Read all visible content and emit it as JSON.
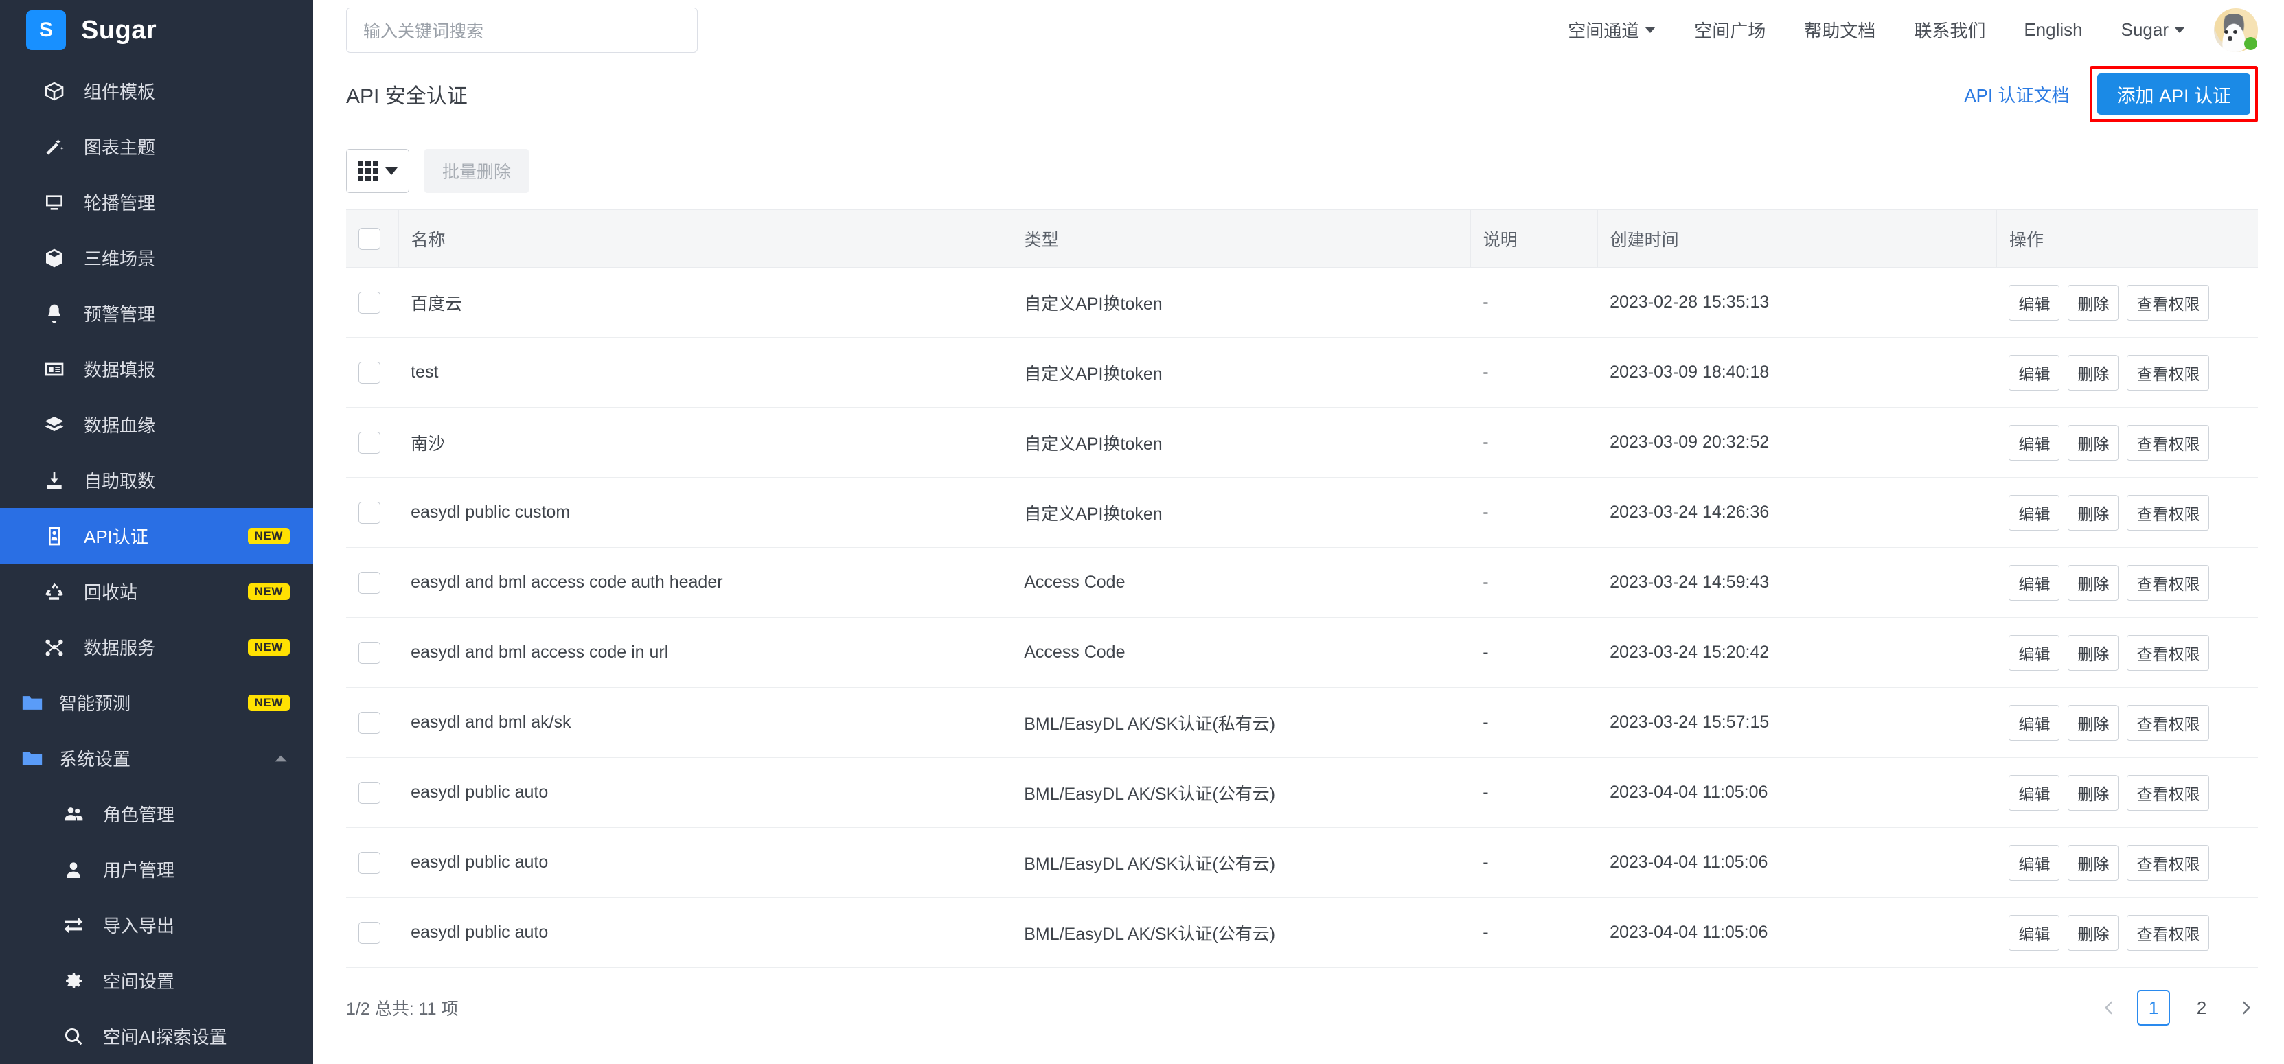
{
  "sidebar": {
    "brand": {
      "logo_letter": "S",
      "name": "Sugar"
    },
    "items": [
      {
        "label": "组件模板",
        "icon": "cube-outline-icon",
        "badge": "",
        "type": "item"
      },
      {
        "label": "图表主题",
        "icon": "magic-wand-icon",
        "badge": "",
        "type": "item"
      },
      {
        "label": "轮播管理",
        "icon": "monitor-icon",
        "badge": "",
        "type": "item"
      },
      {
        "label": "三维场景",
        "icon": "cube-solid-icon",
        "badge": "",
        "type": "item"
      },
      {
        "label": "预警管理",
        "icon": "bell-icon",
        "badge": "",
        "type": "item"
      },
      {
        "label": "数据填报",
        "icon": "id-card-icon",
        "badge": "",
        "type": "item"
      },
      {
        "label": "数据血缘",
        "icon": "layers-icon",
        "badge": "",
        "type": "item"
      },
      {
        "label": "自助取数",
        "icon": "download-icon",
        "badge": "",
        "type": "item"
      },
      {
        "label": "API认证",
        "icon": "api-badge-icon",
        "badge": "NEW",
        "type": "item",
        "active": true
      },
      {
        "label": "回收站",
        "icon": "recycle-icon",
        "badge": "NEW",
        "type": "item"
      },
      {
        "label": "数据服务",
        "icon": "nodes-icon",
        "badge": "NEW",
        "type": "item"
      },
      {
        "label": "智能预测",
        "icon": "folder-icon",
        "badge": "NEW",
        "type": "group"
      },
      {
        "label": "系统设置",
        "icon": "folder-icon",
        "badge": "",
        "type": "group",
        "expanded": true
      },
      {
        "label": "角色管理",
        "icon": "users-icon",
        "badge": "",
        "type": "child"
      },
      {
        "label": "用户管理",
        "icon": "user-icon",
        "badge": "",
        "type": "child"
      },
      {
        "label": "导入导出",
        "icon": "exchange-icon",
        "badge": "",
        "type": "child"
      },
      {
        "label": "空间设置",
        "icon": "gear-icon",
        "badge": "",
        "type": "child"
      },
      {
        "label": "空间AI探索设置",
        "icon": "search-icon",
        "badge": "",
        "type": "child"
      }
    ]
  },
  "topbar": {
    "search_placeholder": "输入关键词搜索",
    "nav": [
      {
        "label": "空间通道",
        "has_caret": true
      },
      {
        "label": "空间广场",
        "has_caret": false
      },
      {
        "label": "帮助文档",
        "has_caret": false
      },
      {
        "label": "联系我们",
        "has_caret": false
      },
      {
        "label": "English",
        "has_caret": false
      },
      {
        "label": "Sugar",
        "has_caret": true
      }
    ]
  },
  "pagehead": {
    "title": "API 安全认证",
    "doc_link": "API 认证文档",
    "add_button": "添加 API 认证",
    "highlight_color": "#ff0000",
    "accent_color": "#1b8ae6"
  },
  "toolbar": {
    "grid_button_icon": "grid-icon",
    "batch_delete": "批量删除"
  },
  "table": {
    "columns": [
      "名称",
      "类型",
      "说明",
      "创建时间",
      "操作"
    ],
    "op_labels": {
      "edit": "编辑",
      "delete": "删除",
      "permission": "查看权限"
    },
    "rows": [
      {
        "name": "百度云",
        "type": "自定义API换token",
        "desc": "-",
        "created": "2023-02-28 15:35:13"
      },
      {
        "name": "test",
        "type": "自定义API换token",
        "desc": "-",
        "created": "2023-03-09 18:40:18"
      },
      {
        "name": "南沙",
        "type": "自定义API换token",
        "desc": "-",
        "created": "2023-03-09 20:32:52"
      },
      {
        "name": "easydl public custom",
        "type": "自定义API换token",
        "desc": "-",
        "created": "2023-03-24 14:26:36"
      },
      {
        "name": "easydl and bml access code auth header",
        "type": "Access Code",
        "desc": "-",
        "created": "2023-03-24 14:59:43"
      },
      {
        "name": "easydl and bml access code in url",
        "type": "Access Code",
        "desc": "-",
        "created": "2023-03-24 15:20:42"
      },
      {
        "name": "easydl and bml ak/sk",
        "type": "BML/EasyDL AK/SK认证(私有云)",
        "desc": "-",
        "created": "2023-03-24 15:57:15"
      },
      {
        "name": "easydl public auto",
        "type": "BML/EasyDL AK/SK认证(公有云)",
        "desc": "-",
        "created": "2023-04-04 11:05:06"
      },
      {
        "name": "easydl public auto",
        "type": "BML/EasyDL AK/SK认证(公有云)",
        "desc": "-",
        "created": "2023-04-04 11:05:06"
      },
      {
        "name": "easydl public auto",
        "type": "BML/EasyDL AK/SK认证(公有云)",
        "desc": "-",
        "created": "2023-04-04 11:05:06"
      }
    ]
  },
  "footer": {
    "total_text": "1/2 总共: 11 项",
    "pages": [
      "1",
      "2"
    ],
    "current_page": "1"
  }
}
